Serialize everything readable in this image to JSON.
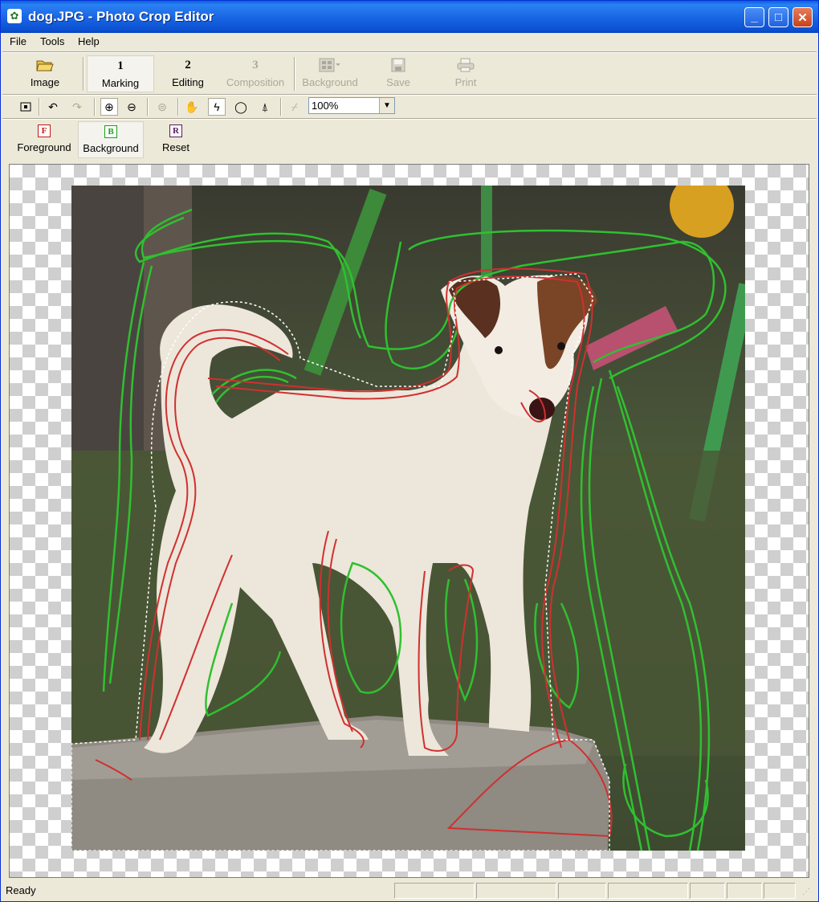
{
  "window": {
    "title": "dog.JPG - Photo Crop Editor",
    "min": "_",
    "max": "□",
    "close": "✕"
  },
  "menu": {
    "file": "File",
    "tools": "Tools",
    "help": "Help"
  },
  "toolbar1": {
    "image": "Image",
    "marking_num": "1",
    "marking": "Marking",
    "editing_num": "2",
    "editing": "Editing",
    "composition_num": "3",
    "composition": "Composition",
    "background": "Background",
    "save": "Save",
    "print": "Print"
  },
  "toolbar2": {
    "zoom": "100%"
  },
  "toolbar3": {
    "foreground_glyph": "F",
    "foreground": "Foreground",
    "background_glyph": "B",
    "background": "Background",
    "reset_glyph": "R",
    "reset": "Reset"
  },
  "status": {
    "text": "Ready"
  },
  "colors": {
    "foreground_mark": "#d03030",
    "background_mark": "#30c030",
    "title_bar": "#0a5fd8"
  },
  "icons": [
    "folder-open-icon",
    "save-disk-icon",
    "printer-icon",
    "background-grid-icon",
    "crop-icon",
    "undo-icon",
    "redo-icon",
    "zoom-in-icon",
    "zoom-out-icon",
    "fit-icon",
    "hand-icon",
    "brush-icon",
    "ellipse-select-icon",
    "magic-wand-icon",
    "eraser-icon"
  ]
}
